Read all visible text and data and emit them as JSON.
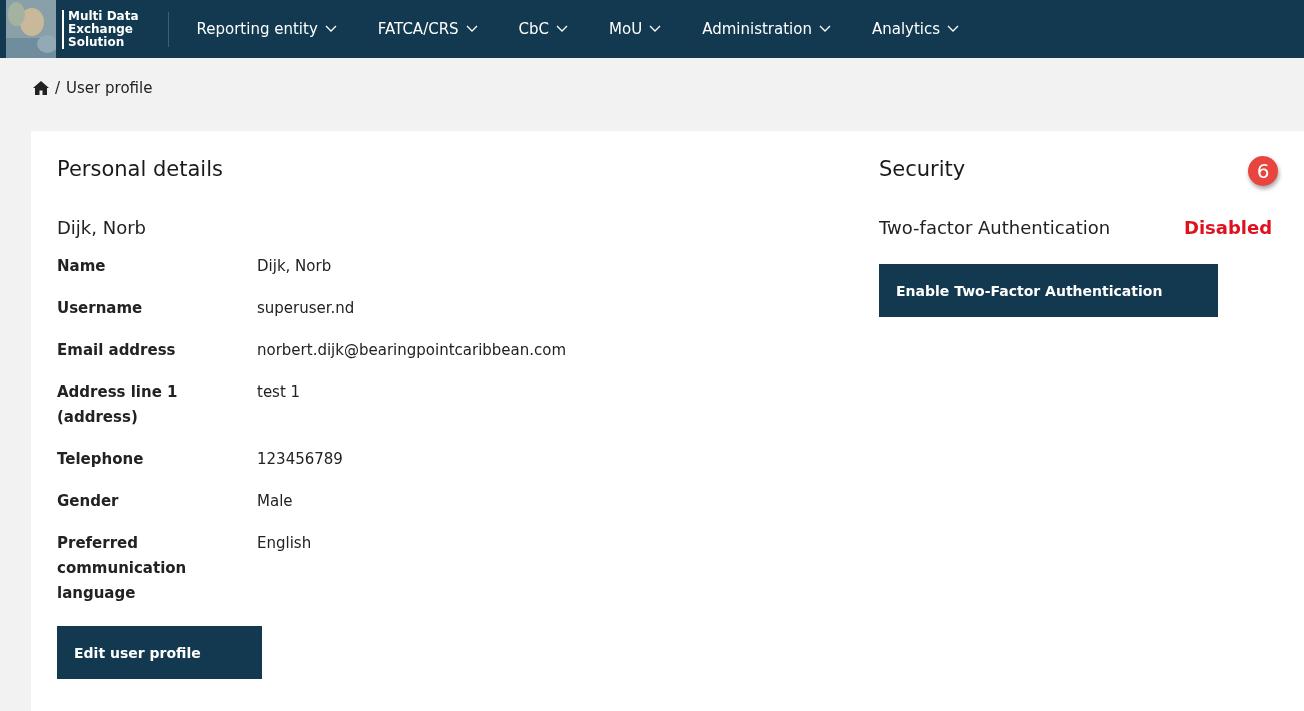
{
  "navbar": {
    "logo_text": [
      "Multi Data",
      "Exchange",
      "Solution"
    ],
    "menu": [
      {
        "label": "Reporting entity"
      },
      {
        "label": "FATCA/CRS"
      },
      {
        "label": "CbC"
      },
      {
        "label": "MoU"
      },
      {
        "label": "Administration"
      },
      {
        "label": "Analytics"
      }
    ]
  },
  "breadcrumb": {
    "separator": "/",
    "current": "User profile"
  },
  "personal_details": {
    "title": "Personal details",
    "name_heading": "Dijk, Norb",
    "fields": [
      {
        "label": "Name",
        "value": "Dijk, Norb"
      },
      {
        "label": "Username",
        "value": "superuser.nd"
      },
      {
        "label": "Email address",
        "value": "norbert.dijk@bearingpointcaribbean.com"
      },
      {
        "label": "Address line 1 (address)",
        "value": "test 1"
      },
      {
        "label": "Telephone",
        "value": "123456789"
      },
      {
        "label": "Gender",
        "value": "Male"
      },
      {
        "label": "Preferred communication language",
        "value": "English"
      }
    ],
    "button": "Edit user profile"
  },
  "security": {
    "title": "Security",
    "callout": "6",
    "two_factor_label": "Two-factor Authentication",
    "two_factor_status": "Disabled",
    "enabled": false,
    "button": "Enable Two-Factor Authentication"
  }
}
